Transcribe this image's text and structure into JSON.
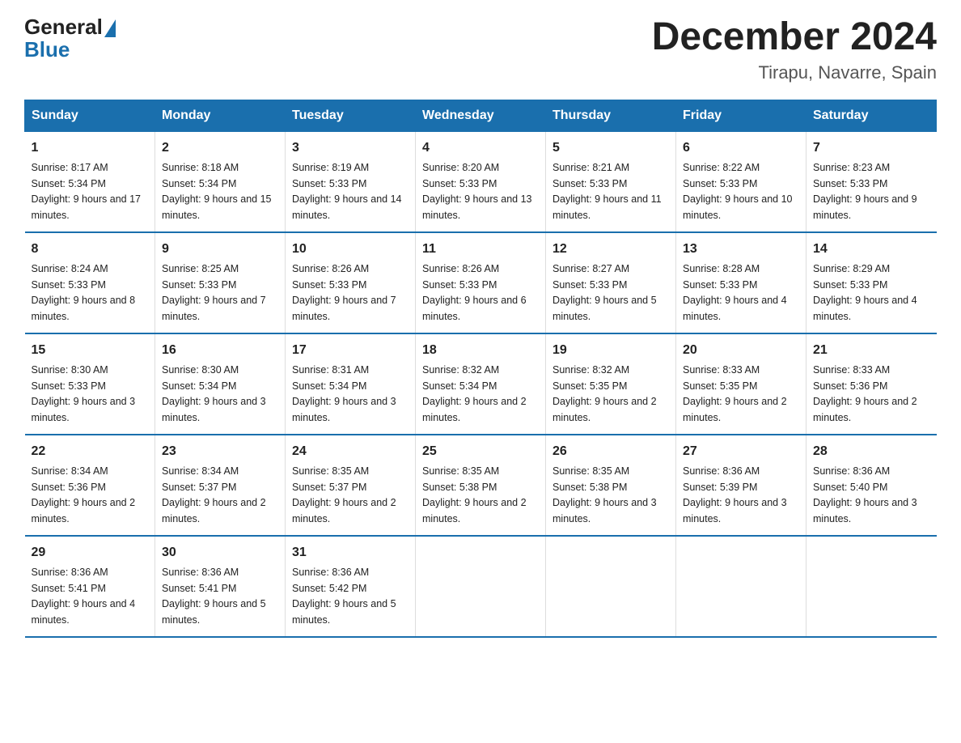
{
  "logo": {
    "general": "General",
    "blue": "Blue"
  },
  "header": {
    "month_year": "December 2024",
    "location": "Tirapu, Navarre, Spain"
  },
  "days_of_week": [
    "Sunday",
    "Monday",
    "Tuesday",
    "Wednesday",
    "Thursday",
    "Friday",
    "Saturday"
  ],
  "weeks": [
    [
      {
        "day": "1",
        "sunrise": "8:17 AM",
        "sunset": "5:34 PM",
        "daylight": "9 hours and 17 minutes."
      },
      {
        "day": "2",
        "sunrise": "8:18 AM",
        "sunset": "5:34 PM",
        "daylight": "9 hours and 15 minutes."
      },
      {
        "day": "3",
        "sunrise": "8:19 AM",
        "sunset": "5:33 PM",
        "daylight": "9 hours and 14 minutes."
      },
      {
        "day": "4",
        "sunrise": "8:20 AM",
        "sunset": "5:33 PM",
        "daylight": "9 hours and 13 minutes."
      },
      {
        "day": "5",
        "sunrise": "8:21 AM",
        "sunset": "5:33 PM",
        "daylight": "9 hours and 11 minutes."
      },
      {
        "day": "6",
        "sunrise": "8:22 AM",
        "sunset": "5:33 PM",
        "daylight": "9 hours and 10 minutes."
      },
      {
        "day": "7",
        "sunrise": "8:23 AM",
        "sunset": "5:33 PM",
        "daylight": "9 hours and 9 minutes."
      }
    ],
    [
      {
        "day": "8",
        "sunrise": "8:24 AM",
        "sunset": "5:33 PM",
        "daylight": "9 hours and 8 minutes."
      },
      {
        "day": "9",
        "sunrise": "8:25 AM",
        "sunset": "5:33 PM",
        "daylight": "9 hours and 7 minutes."
      },
      {
        "day": "10",
        "sunrise": "8:26 AM",
        "sunset": "5:33 PM",
        "daylight": "9 hours and 7 minutes."
      },
      {
        "day": "11",
        "sunrise": "8:26 AM",
        "sunset": "5:33 PM",
        "daylight": "9 hours and 6 minutes."
      },
      {
        "day": "12",
        "sunrise": "8:27 AM",
        "sunset": "5:33 PM",
        "daylight": "9 hours and 5 minutes."
      },
      {
        "day": "13",
        "sunrise": "8:28 AM",
        "sunset": "5:33 PM",
        "daylight": "9 hours and 4 minutes."
      },
      {
        "day": "14",
        "sunrise": "8:29 AM",
        "sunset": "5:33 PM",
        "daylight": "9 hours and 4 minutes."
      }
    ],
    [
      {
        "day": "15",
        "sunrise": "8:30 AM",
        "sunset": "5:33 PM",
        "daylight": "9 hours and 3 minutes."
      },
      {
        "day": "16",
        "sunrise": "8:30 AM",
        "sunset": "5:34 PM",
        "daylight": "9 hours and 3 minutes."
      },
      {
        "day": "17",
        "sunrise": "8:31 AM",
        "sunset": "5:34 PM",
        "daylight": "9 hours and 3 minutes."
      },
      {
        "day": "18",
        "sunrise": "8:32 AM",
        "sunset": "5:34 PM",
        "daylight": "9 hours and 2 minutes."
      },
      {
        "day": "19",
        "sunrise": "8:32 AM",
        "sunset": "5:35 PM",
        "daylight": "9 hours and 2 minutes."
      },
      {
        "day": "20",
        "sunrise": "8:33 AM",
        "sunset": "5:35 PM",
        "daylight": "9 hours and 2 minutes."
      },
      {
        "day": "21",
        "sunrise": "8:33 AM",
        "sunset": "5:36 PM",
        "daylight": "9 hours and 2 minutes."
      }
    ],
    [
      {
        "day": "22",
        "sunrise": "8:34 AM",
        "sunset": "5:36 PM",
        "daylight": "9 hours and 2 minutes."
      },
      {
        "day": "23",
        "sunrise": "8:34 AM",
        "sunset": "5:37 PM",
        "daylight": "9 hours and 2 minutes."
      },
      {
        "day": "24",
        "sunrise": "8:35 AM",
        "sunset": "5:37 PM",
        "daylight": "9 hours and 2 minutes."
      },
      {
        "day": "25",
        "sunrise": "8:35 AM",
        "sunset": "5:38 PM",
        "daylight": "9 hours and 2 minutes."
      },
      {
        "day": "26",
        "sunrise": "8:35 AM",
        "sunset": "5:38 PM",
        "daylight": "9 hours and 3 minutes."
      },
      {
        "day": "27",
        "sunrise": "8:36 AM",
        "sunset": "5:39 PM",
        "daylight": "9 hours and 3 minutes."
      },
      {
        "day": "28",
        "sunrise": "8:36 AM",
        "sunset": "5:40 PM",
        "daylight": "9 hours and 3 minutes."
      }
    ],
    [
      {
        "day": "29",
        "sunrise": "8:36 AM",
        "sunset": "5:41 PM",
        "daylight": "9 hours and 4 minutes."
      },
      {
        "day": "30",
        "sunrise": "8:36 AM",
        "sunset": "5:41 PM",
        "daylight": "9 hours and 5 minutes."
      },
      {
        "day": "31",
        "sunrise": "8:36 AM",
        "sunset": "5:42 PM",
        "daylight": "9 hours and 5 minutes."
      },
      null,
      null,
      null,
      null
    ]
  ]
}
